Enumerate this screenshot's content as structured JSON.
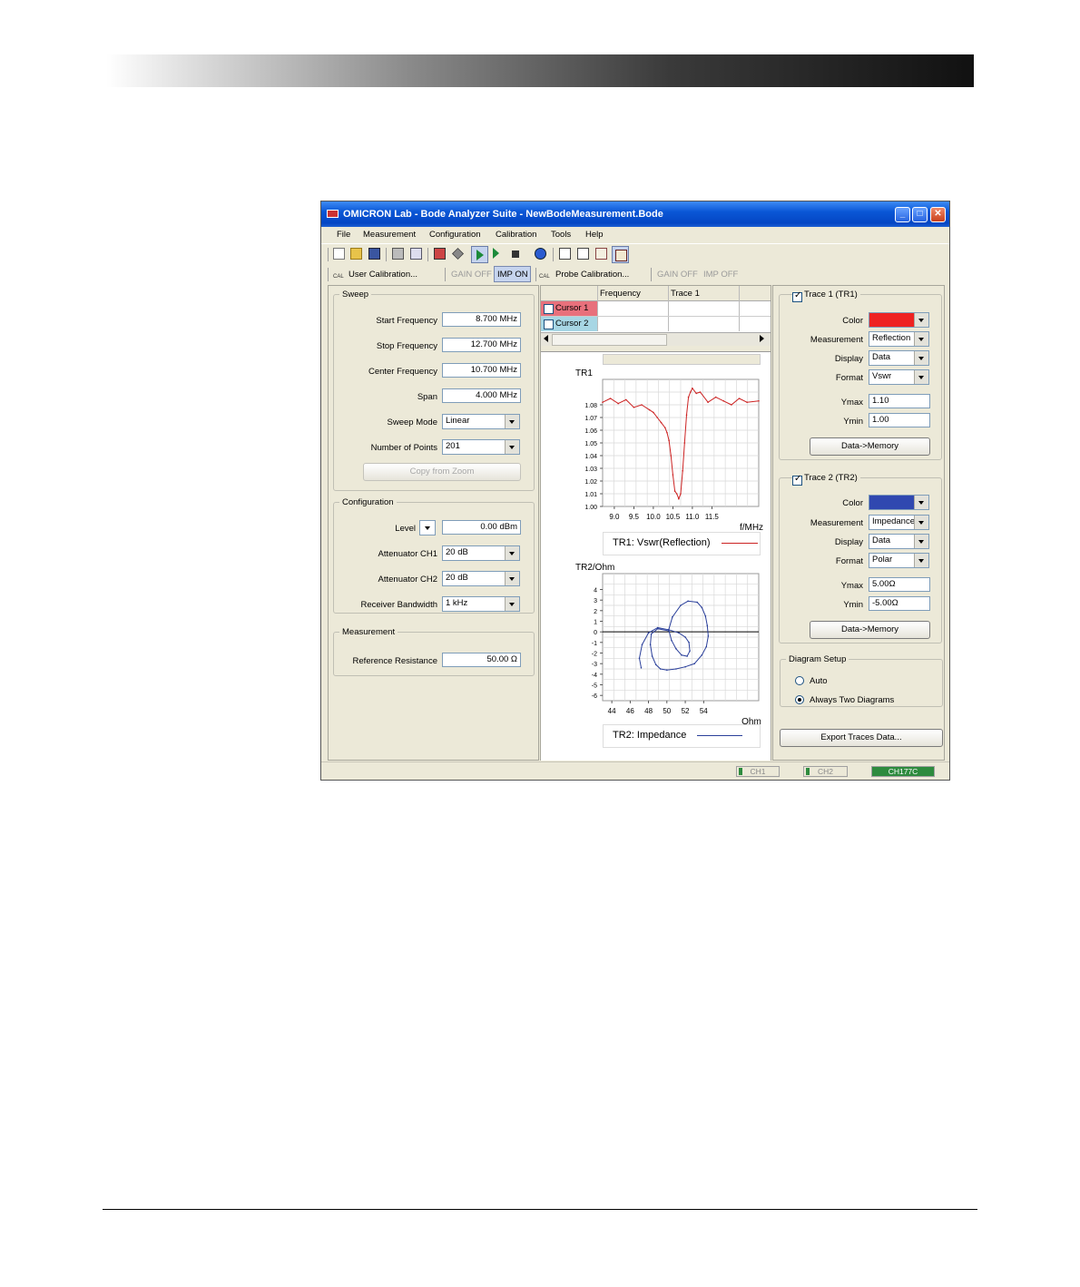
{
  "window": {
    "title": "OMICRON Lab - Bode Analyzer Suite - NewBodeMeasurement.Bode"
  },
  "menu": [
    "File",
    "Measurement",
    "Configuration",
    "Calibration",
    "Tools",
    "Help"
  ],
  "toolbar": {
    "icons": [
      "new-file-icon",
      "open-folder-icon",
      "save-icon",
      "print-icon",
      "print-preview-icon",
      "connect-icon",
      "wrench-icon",
      "play-icon",
      "single-sweep-icon",
      "stop-icon",
      "help-icon",
      "single-diagram-icon",
      "two-diagrams-icon",
      "chart-icon",
      "layout-icon"
    ]
  },
  "calbar": {
    "user_calibration": "User Calibration...",
    "gain_off": "GAIN OFF",
    "imp_on": "IMP ON",
    "probe_calibration": "Probe Calibration...",
    "gain_off2": "GAIN OFF",
    "imp_off": "IMP OFF",
    "cal_icon_text": "CAL"
  },
  "sweep": {
    "legend": "Sweep",
    "start_label": "Start Frequency",
    "start_value": "8.700 MHz",
    "stop_label": "Stop Frequency",
    "stop_value": "12.700 MHz",
    "center_label": "Center Frequency",
    "center_value": "10.700 MHz",
    "span_label": "Span",
    "span_value": "4.000 MHz",
    "mode_label": "Sweep Mode",
    "mode_value": "Linear",
    "points_label": "Number of Points",
    "points_value": "201",
    "copy_zoom": "Copy from Zoom"
  },
  "config": {
    "legend": "Configuration",
    "level_label": "Level",
    "level_value": "0.00 dBm",
    "att1_label": "Attenuator CH1",
    "att1_value": "20 dB",
    "att2_label": "Attenuator CH2",
    "att2_value": "20 dB",
    "rbw_label": "Receiver Bandwidth",
    "rbw_value": "1 kHz"
  },
  "measurement": {
    "legend": "Measurement",
    "ref_label": "Reference Resistance",
    "ref_value": "50.00 Ω"
  },
  "cursor_table": {
    "headers": [
      "",
      "Frequency",
      "Trace 1"
    ],
    "rows": [
      "Cursor 1",
      "Cursor 2"
    ],
    "cursor1_color": "#e8707c",
    "cursor2_color": "#a7d6e4"
  },
  "chart_data": [
    {
      "type": "line",
      "title": "",
      "ylabel": "TR1",
      "xlabel": "f/MHz",
      "xlim": [
        8.7,
        12.7
      ],
      "ylim": [
        1.0,
        1.1
      ],
      "xticks": [
        "9.0",
        "9.5",
        "10.0",
        "10.5",
        "11.0",
        "11.5"
      ],
      "yticks": [
        "1.08",
        "1.07",
        "1.06",
        "1.05",
        "1.04",
        "1.03",
        "1.02",
        "1.01",
        "1.00"
      ],
      "grid": true,
      "legend_text": "TR1: Vswr(Reflection)",
      "series": [
        {
          "name": "TR1: Vswr(Reflection)",
          "color": "#cc2222",
          "x": [
            8.7,
            8.9,
            9.1,
            9.3,
            9.5,
            9.7,
            9.9,
            10.0,
            10.1,
            10.2,
            10.3,
            10.35,
            10.4,
            10.45,
            10.5,
            10.55,
            10.6,
            10.65,
            10.7,
            10.75,
            10.8,
            10.85,
            10.9,
            10.95,
            11.0,
            11.1,
            11.2,
            11.4,
            11.6,
            11.8,
            12.0,
            12.2,
            12.4,
            12.7
          ],
          "y": [
            1.082,
            1.085,
            1.081,
            1.084,
            1.078,
            1.08,
            1.076,
            1.074,
            1.07,
            1.066,
            1.062,
            1.058,
            1.052,
            1.04,
            1.025,
            1.012,
            1.01,
            1.006,
            1.01,
            1.028,
            1.05,
            1.072,
            1.086,
            1.09,
            1.093,
            1.089,
            1.09,
            1.082,
            1.086,
            1.083,
            1.08,
            1.085,
            1.082,
            1.083
          ]
        }
      ]
    },
    {
      "type": "scatter",
      "title": "",
      "ylabel": "TR2/Ohm",
      "xlabel": "Ohm",
      "xlim": [
        43,
        60
      ],
      "ylim": [
        -6.5,
        5.5
      ],
      "xticks": [
        "44",
        "46",
        "48",
        "50",
        "52",
        "54"
      ],
      "yticks": [
        "4",
        "3",
        "2",
        "1",
        "0",
        "-1",
        "-2",
        "-3",
        "-4",
        "-5",
        "-6"
      ],
      "grid": true,
      "legend_text": "TR2: Impedance",
      "series": [
        {
          "name": "TR2: Impedance",
          "color": "#2a3f9a",
          "x": [
            47.2,
            47.0,
            47.3,
            48.0,
            49.0,
            50.2,
            51.3,
            52.0,
            52.4,
            52.5,
            52.2,
            51.6,
            51.0,
            50.5,
            50.2,
            50.6,
            51.5,
            52.3,
            53.3,
            53.8,
            54.2,
            54.4,
            54.5,
            54.3,
            53.8,
            53.0,
            52.0,
            51.0,
            50.0,
            49.3,
            48.8,
            48.4,
            48.2,
            48.3,
            49.0,
            50.2
          ],
          "y": [
            -3.4,
            -2.5,
            -1.2,
            -0.1,
            0.4,
            0.2,
            -0.1,
            -0.5,
            -1.0,
            -1.8,
            -2.3,
            -2.2,
            -1.6,
            -0.8,
            0.2,
            1.4,
            2.5,
            2.9,
            2.8,
            2.3,
            1.5,
            0.6,
            -0.4,
            -1.4,
            -2.2,
            -3.0,
            -3.3,
            -3.5,
            -3.6,
            -3.5,
            -3.1,
            -2.3,
            -1.2,
            -0.2,
            0.3,
            0.1
          ]
        }
      ]
    }
  ],
  "trace1": {
    "legend": "Trace 1 (TR1)",
    "color_label": "Color",
    "color_hex": "#ee2222",
    "meas_label": "Measurement",
    "meas_value": "Reflection",
    "disp_label": "Display",
    "disp_value": "Data",
    "fmt_label": "Format",
    "fmt_value": "Vswr",
    "ymax_label": "Ymax",
    "ymax_value": "1.10",
    "ymin_label": "Ymin",
    "ymin_value": "1.00",
    "btn": "Data->Memory"
  },
  "trace2": {
    "legend": "Trace 2 (TR2)",
    "color_label": "Color",
    "color_hex": "#3048b0",
    "meas_label": "Measurement",
    "meas_value": "Impedance",
    "disp_label": "Display",
    "disp_value": "Data",
    "fmt_label": "Format",
    "fmt_value": "Polar",
    "ymax_label": "Ymax",
    "ymax_value": "5.00Ω",
    "ymin_label": "Ymin",
    "ymin_value": "-5.00Ω",
    "btn": "Data->Memory"
  },
  "diagram": {
    "legend": "Diagram Setup",
    "auto": "Auto",
    "two": "Always Two Diagrams"
  },
  "export_btn": "Export Traces Data...",
  "status": {
    "ch1": "CH1",
    "ch2": "CH2",
    "device": "CH177C",
    "device_color": "#2e8b3e"
  }
}
